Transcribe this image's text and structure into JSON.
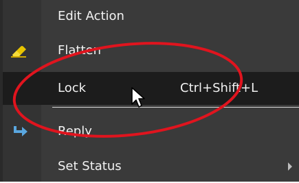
{
  "context_menu": {
    "items": [
      {
        "label": "Edit Action",
        "icon": "none"
      },
      {
        "label": "Flatten",
        "icon": "eraser-icon"
      },
      {
        "label": "Lock",
        "shortcut": "Ctrl+Shift+L",
        "icon": "none",
        "highlighted": true
      },
      {
        "label": "Reply",
        "icon": "reply-arrow-icon"
      },
      {
        "label": "Set Status",
        "icon": "none",
        "has_submenu": true
      }
    ]
  },
  "annotation": {
    "type": "red-ellipse",
    "color": "#e0141e"
  },
  "colors": {
    "menu_background": "#3a3a3a",
    "highlight_background": "#1c1c1c",
    "text": "#f2f2f2",
    "eraser_icon": "#e8c400",
    "reply_icon": "#5aa7e0"
  }
}
